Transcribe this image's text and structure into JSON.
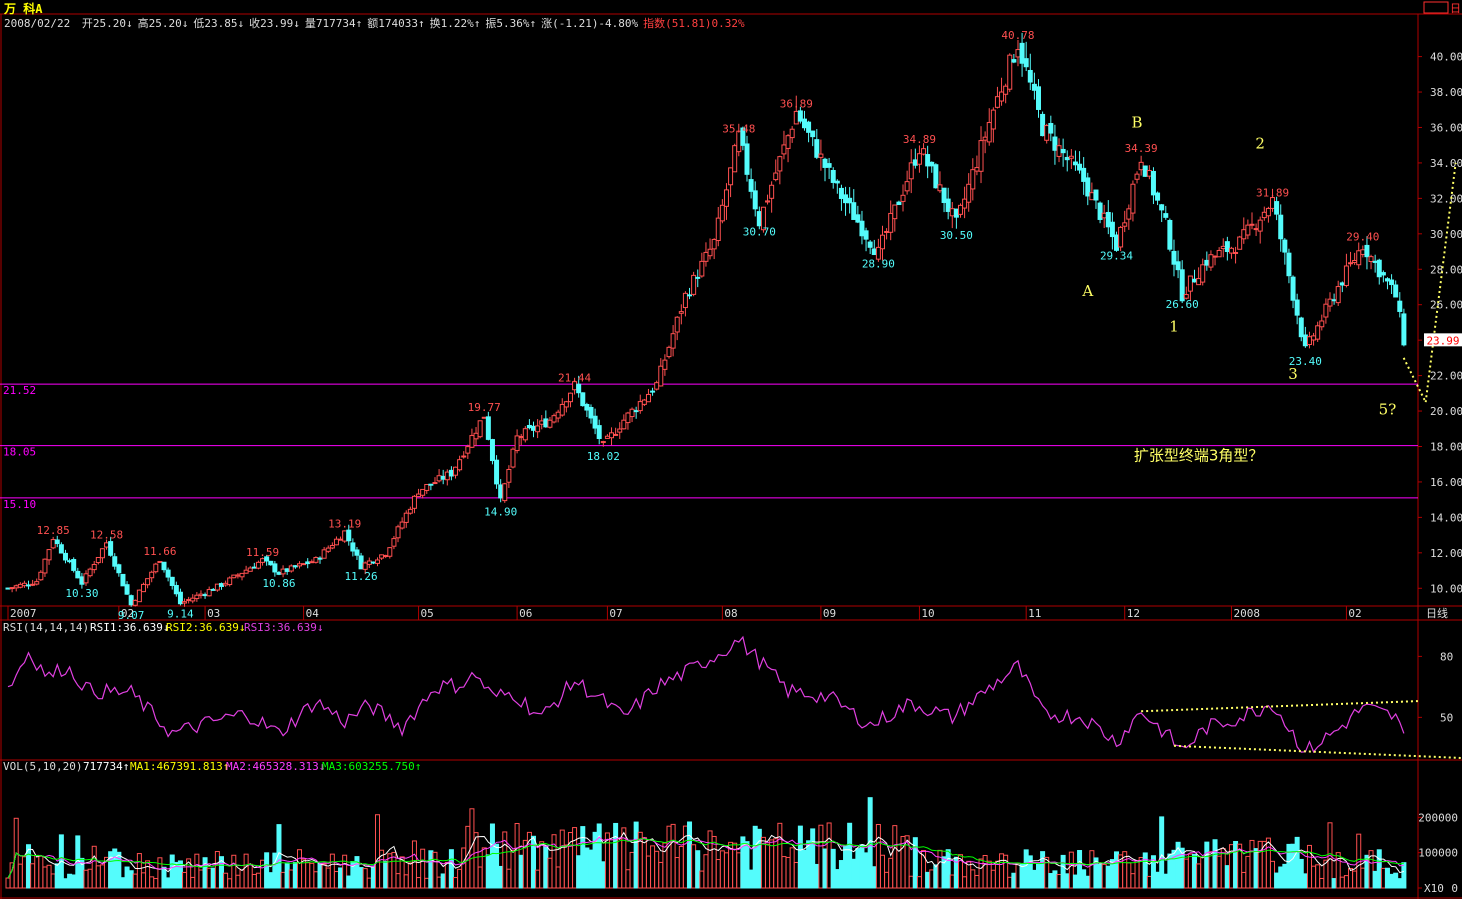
{
  "title": "万 科A",
  "header": {
    "date": "2008/02/22",
    "items": [
      {
        "text": "开25.20",
        "color": "#dddddd"
      },
      {
        "text": "高25.20",
        "color": "#dddddd"
      },
      {
        "text": "低23.85",
        "color": "#dddddd"
      },
      {
        "text": "收23.99",
        "color": "#dddddd"
      },
      {
        "text": "量717734",
        "color": "#dddddd"
      },
      {
        "text": "额174033",
        "color": "#dddddd"
      },
      {
        "text": "换1.22%",
        "color": "#dddddd"
      },
      {
        "text": "振5.36%",
        "color": "#dddddd"
      },
      {
        "text": "涨(-1.21)-4.80%",
        "color": "#dddddd"
      },
      {
        "text": "指数(51.81)0.32%",
        "color": "#ff4040"
      }
    ],
    "arrows": [
      "↓",
      "↓",
      "↓",
      "↓",
      "↑",
      "↑",
      "↑",
      "↑",
      "",
      ""
    ]
  },
  "corner_label": "日",
  "colors": {
    "up": "#ff5050",
    "down": "#54fcfc",
    "grid": "#b00000",
    "axis_text": "#dddddd",
    "hline": "#ff00ff",
    "hi_label": "#ff5050",
    "lo_label": "#54fcfc",
    "wave": "#ffff66",
    "rsi": "#e040e0",
    "ma1": "#ffffff",
    "ma2": "#ff40ff",
    "ma3": "#00ff00"
  },
  "chart_data": [
    {
      "type": "candlestick",
      "ylim": [
        9,
        41.5
      ],
      "yticks": [
        10,
        12,
        14,
        16,
        18,
        20,
        22,
        24,
        26,
        28,
        30,
        32,
        34,
        36,
        38,
        40
      ],
      "ytick_labels": [
        "10.00",
        "12.00",
        "14.00",
        "16.00",
        "18.00",
        "20.00",
        "22.00",
        "24.00",
        "26.00",
        "28.00",
        "30.00",
        "32.00",
        "34.00",
        "36.00",
        "38.00",
        "40.00"
      ],
      "x_labels": [
        "2007",
        "02",
        "03",
        "04",
        "05",
        "06",
        "07",
        "08",
        "09",
        "10",
        "11",
        "12",
        "2008",
        "02"
      ],
      "x_unit_label": "日线",
      "last_price": "23.99",
      "price_path": [
        [
          0,
          10.0
        ],
        [
          7,
          10.4
        ],
        [
          11,
          12.85
        ],
        [
          18,
          10.3
        ],
        [
          24,
          12.58
        ],
        [
          30,
          9.07
        ],
        [
          37,
          11.66
        ],
        [
          42,
          9.14
        ],
        [
          52,
          10.2
        ],
        [
          62,
          11.59
        ],
        [
          66,
          10.86
        ],
        [
          75,
          11.6
        ],
        [
          82,
          13.19
        ],
        [
          86,
          11.26
        ],
        [
          92,
          12.0
        ],
        [
          100,
          15.5
        ],
        [
          108,
          16.5
        ],
        [
          116,
          19.77
        ],
        [
          120,
          14.9
        ],
        [
          124,
          18.5
        ],
        [
          132,
          19.5
        ],
        [
          138,
          21.44
        ],
        [
          145,
          18.02
        ],
        [
          150,
          19.5
        ],
        [
          158,
          21.5
        ],
        [
          165,
          26.5
        ],
        [
          172,
          29.5
        ],
        [
          178,
          35.48
        ],
        [
          183,
          30.7
        ],
        [
          192,
          36.89
        ],
        [
          202,
          32.5
        ],
        [
          212,
          28.9
        ],
        [
          222,
          34.89
        ],
        [
          231,
          30.5
        ],
        [
          240,
          37.0
        ],
        [
          246,
          40.78
        ],
        [
          252,
          36.0
        ],
        [
          262,
          33.0
        ],
        [
          270,
          29.34
        ],
        [
          276,
          34.39
        ],
        [
          282,
          30.5
        ],
        [
          286,
          26.6
        ],
        [
          292,
          28.5
        ],
        [
          300,
          29.5
        ],
        [
          308,
          31.89
        ],
        [
          316,
          23.4
        ],
        [
          324,
          27.0
        ],
        [
          330,
          29.4
        ],
        [
          338,
          26.5
        ],
        [
          340,
          23.99
        ]
      ],
      "high_labels": [
        {
          "i": 11,
          "v": "12.85"
        },
        {
          "i": 24,
          "v": "12.58"
        },
        {
          "i": 37,
          "v": "11.66"
        },
        {
          "i": 62,
          "v": "11.59"
        },
        {
          "i": 82,
          "v": "13.19"
        },
        {
          "i": 116,
          "v": "19.77"
        },
        {
          "i": 138,
          "v": "21.44"
        },
        {
          "i": 178,
          "v": "35.48"
        },
        {
          "i": 192,
          "v": "36.89"
        },
        {
          "i": 222,
          "v": "34.89"
        },
        {
          "i": 246,
          "v": "40.78"
        },
        {
          "i": 276,
          "v": "34.39"
        },
        {
          "i": 308,
          "v": "31.89"
        },
        {
          "i": 330,
          "v": "29.40"
        }
      ],
      "low_labels": [
        {
          "i": 18,
          "v": "10.30"
        },
        {
          "i": 30,
          "v": "9.07"
        },
        {
          "i": 42,
          "v": "9.14"
        },
        {
          "i": 66,
          "v": "10.86"
        },
        {
          "i": 86,
          "v": "11.26"
        },
        {
          "i": 120,
          "v": "14.90"
        },
        {
          "i": 145,
          "v": "18.02"
        },
        {
          "i": 183,
          "v": "30.70"
        },
        {
          "i": 212,
          "v": "28.90"
        },
        {
          "i": 231,
          "v": "30.50"
        },
        {
          "i": 270,
          "v": "29.34"
        },
        {
          "i": 286,
          "v": "26.60"
        },
        {
          "i": 316,
          "v": "23.40"
        }
      ],
      "hlines": [
        {
          "value": 21.52,
          "label": "21.52"
        },
        {
          "value": 18.05,
          "label": "18.05"
        },
        {
          "value": 15.1,
          "label": "15.10"
        }
      ],
      "wave_labels": [
        {
          "i": 263,
          "price": 26.5,
          "text": "A"
        },
        {
          "i": 275,
          "price": 36.0,
          "text": "B"
        },
        {
          "i": 284,
          "price": 24.5,
          "text": "1"
        },
        {
          "i": 305,
          "price": 34.8,
          "text": "2"
        },
        {
          "i": 313,
          "price": 21.8,
          "text": "3"
        },
        {
          "i": 336,
          "price": 19.8,
          "text": "5?"
        }
      ],
      "annotation": "扩张型终端3角型？",
      "annotation_price": 17.2,
      "annotation_i": 290
    },
    {
      "type": "line",
      "name": "RSI",
      "legend": [
        "RSI(14,14,14)",
        "RSI1:36.639",
        "RSI2:36.639",
        "RSI3:36.639"
      ],
      "ylim": [
        30,
        92
      ],
      "yticks": [
        50,
        80
      ],
      "rsi_path": [
        [
          0,
          64
        ],
        [
          5,
          82
        ],
        [
          10,
          70
        ],
        [
          14,
          75
        ],
        [
          20,
          63
        ],
        [
          30,
          62
        ],
        [
          40,
          42
        ],
        [
          50,
          48
        ],
        [
          58,
          52
        ],
        [
          66,
          42
        ],
        [
          75,
          58
        ],
        [
          82,
          48
        ],
        [
          88,
          56
        ],
        [
          96,
          45
        ],
        [
          104,
          65
        ],
        [
          110,
          66
        ],
        [
          114,
          71
        ],
        [
          118,
          60
        ],
        [
          123,
          62
        ],
        [
          130,
          50
        ],
        [
          138,
          68
        ],
        [
          145,
          58
        ],
        [
          150,
          50
        ],
        [
          158,
          65
        ],
        [
          165,
          72
        ],
        [
          172,
          80
        ],
        [
          178,
          88
        ],
        [
          183,
          78
        ],
        [
          190,
          63
        ],
        [
          200,
          60
        ],
        [
          210,
          46
        ],
        [
          220,
          57
        ],
        [
          230,
          50
        ],
        [
          240,
          66
        ],
        [
          246,
          75
        ],
        [
          252,
          52
        ],
        [
          262,
          50
        ],
        [
          270,
          38
        ],
        [
          276,
          53
        ],
        [
          282,
          42
        ],
        [
          286,
          34
        ],
        [
          292,
          45
        ],
        [
          300,
          50
        ],
        [
          308,
          57
        ],
        [
          316,
          33
        ],
        [
          324,
          44
        ],
        [
          330,
          55
        ],
        [
          338,
          50
        ],
        [
          340,
          40
        ]
      ]
    },
    {
      "type": "bar",
      "name": "VOL",
      "legend": [
        "VOL(5,10,20)",
        "717734",
        "MA1:467391.813",
        "MA2:465328.313",
        "MA3:603255.750"
      ],
      "ylim": [
        0,
        320000
      ],
      "yticks": [
        0,
        100000,
        200000
      ],
      "ytick_labels": [
        "0",
        "100000",
        "200000"
      ],
      "unit_label": "X10",
      "last_volume": 717734
    }
  ]
}
